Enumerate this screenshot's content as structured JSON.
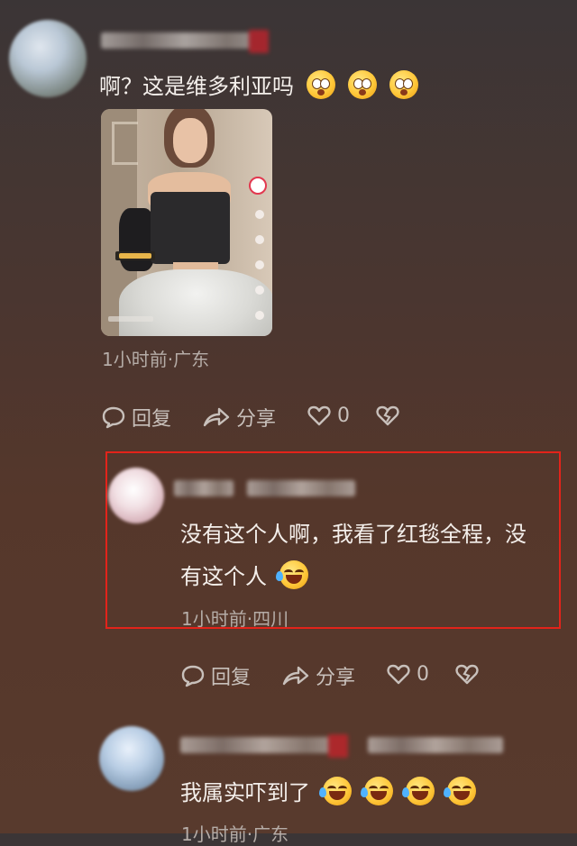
{
  "comments": [
    {
      "text": "啊？这是维多利亚吗",
      "emojis": [
        "astonished-emoji",
        "astonished-emoji",
        "astonished-emoji"
      ],
      "meta": "1小时前·广东",
      "actions": {
        "reply": "回复",
        "share": "分享",
        "likes": "0"
      }
    },
    {
      "line1": "没有这个人啊，我看了红毯全程，没",
      "line2": "有这个人",
      "emojis": [
        "laughing-tears-emoji"
      ],
      "meta": "1小时前·四川",
      "actions": {
        "reply": "回复",
        "share": "分享",
        "likes": "0"
      }
    },
    {
      "text": "我属实吓到了",
      "emojis": [
        "laughing-tears-emoji",
        "laughing-tears-emoji",
        "laughing-tears-emoji",
        "laughing-tears-emoji"
      ],
      "meta": "1小时前·广东"
    }
  ],
  "colors": {
    "highlight": "#e3231a",
    "badge_red": "#d0212b"
  }
}
